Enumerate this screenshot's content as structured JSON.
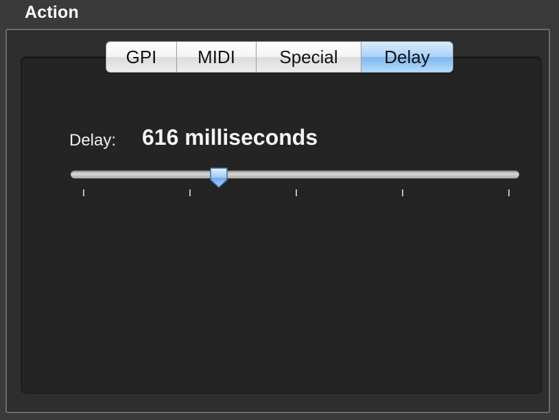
{
  "panel": {
    "title": "Action"
  },
  "tabs": [
    {
      "label": "GPI",
      "selected": false
    },
    {
      "label": "MIDI",
      "selected": false
    },
    {
      "label": "Special",
      "selected": false
    },
    {
      "label": "Delay",
      "selected": true
    }
  ],
  "delay": {
    "label": "Delay:",
    "value_text": "616 milliseconds",
    "slider_fraction": 0.32,
    "tick_count": 5
  },
  "colors": {
    "accent": "#8cc3f5",
    "background": "#242424",
    "text": "#f0f0f0"
  }
}
